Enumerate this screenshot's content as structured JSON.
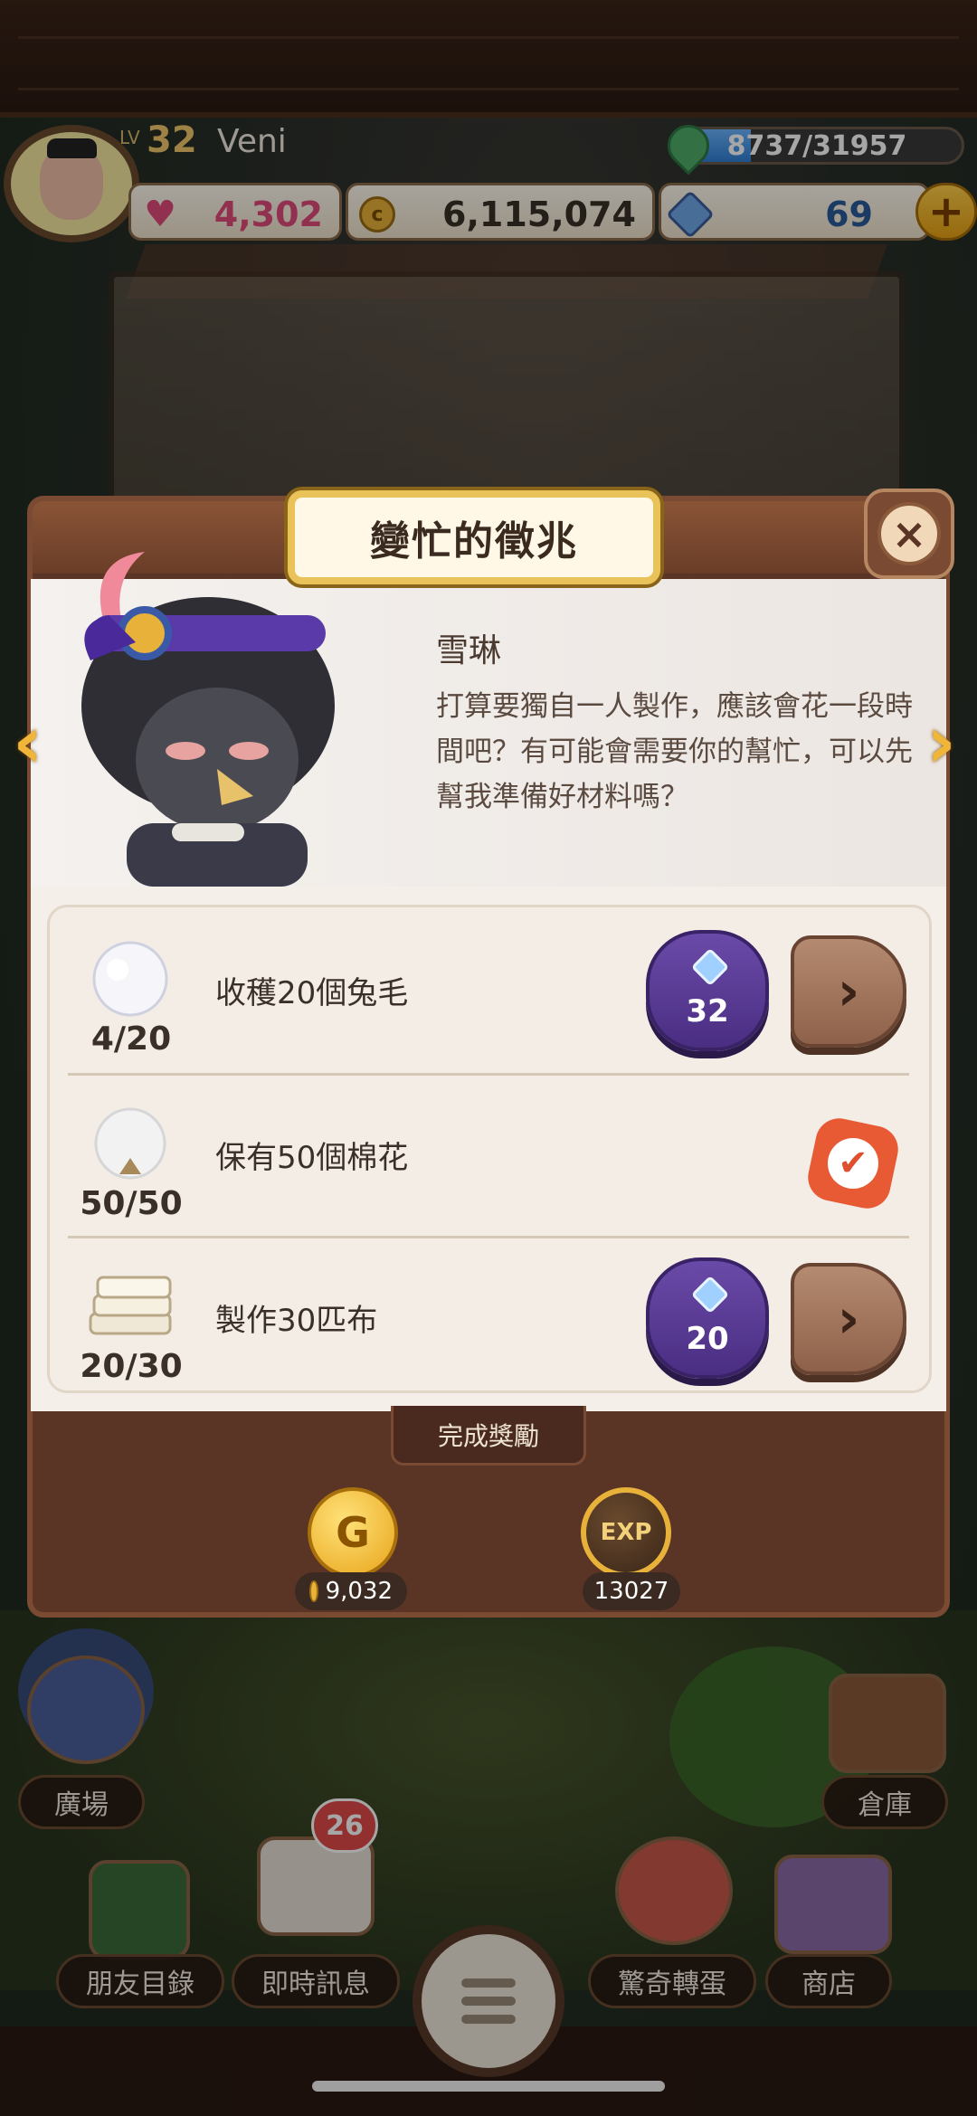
{
  "hud": {
    "level_label": "LV",
    "level": "32",
    "player_name": "Veni",
    "exp_text": "8737/31957",
    "exp_fraction": 0.273,
    "hearts": "4,302",
    "coins": "6,115,074",
    "gems": "69",
    "plus_label": "+"
  },
  "dialog": {
    "title": "變忙的徵兆",
    "close_label": "×",
    "speaker": "雪琳",
    "message": "打算要獨自一人製作，應該會花一段時間吧？有可能會需要你的幫忙，可以先幫我準備好材料嗎？",
    "prev_label": "‹",
    "next_label": "›",
    "tasks": [
      {
        "label": "收穫20個兔毛",
        "progress": "4/20",
        "gem_cost": "32",
        "go_label": "›",
        "icon": "rabbit-fur-icon",
        "done": false
      },
      {
        "label": "保有50個棉花",
        "progress": "50/50",
        "check_label": "✔",
        "icon": "cotton-icon",
        "done": true
      },
      {
        "label": "製作30匹布",
        "progress": "20/30",
        "gem_cost": "20",
        "go_label": "›",
        "icon": "cloth-icon",
        "done": false
      }
    ],
    "reward_header": "完成獎勵",
    "rewards": {
      "gold_icon_text": "G",
      "gold_amount": "9,032",
      "exp_icon_text": "EXP",
      "exp_amount": "13027"
    }
  },
  "bottom_nav": {
    "plaza": "廣場",
    "warehouse": "倉庫",
    "friends": "朋友目錄",
    "messages": "即時訊息",
    "messages_badge": "26",
    "gacha": "驚奇轉蛋",
    "shop": "商店"
  },
  "colors": {
    "accent_gold": "#f0b63a",
    "gem_button": "#4a2e82",
    "check_badge": "#e85a34",
    "dialog_wood": "#5a3425"
  }
}
